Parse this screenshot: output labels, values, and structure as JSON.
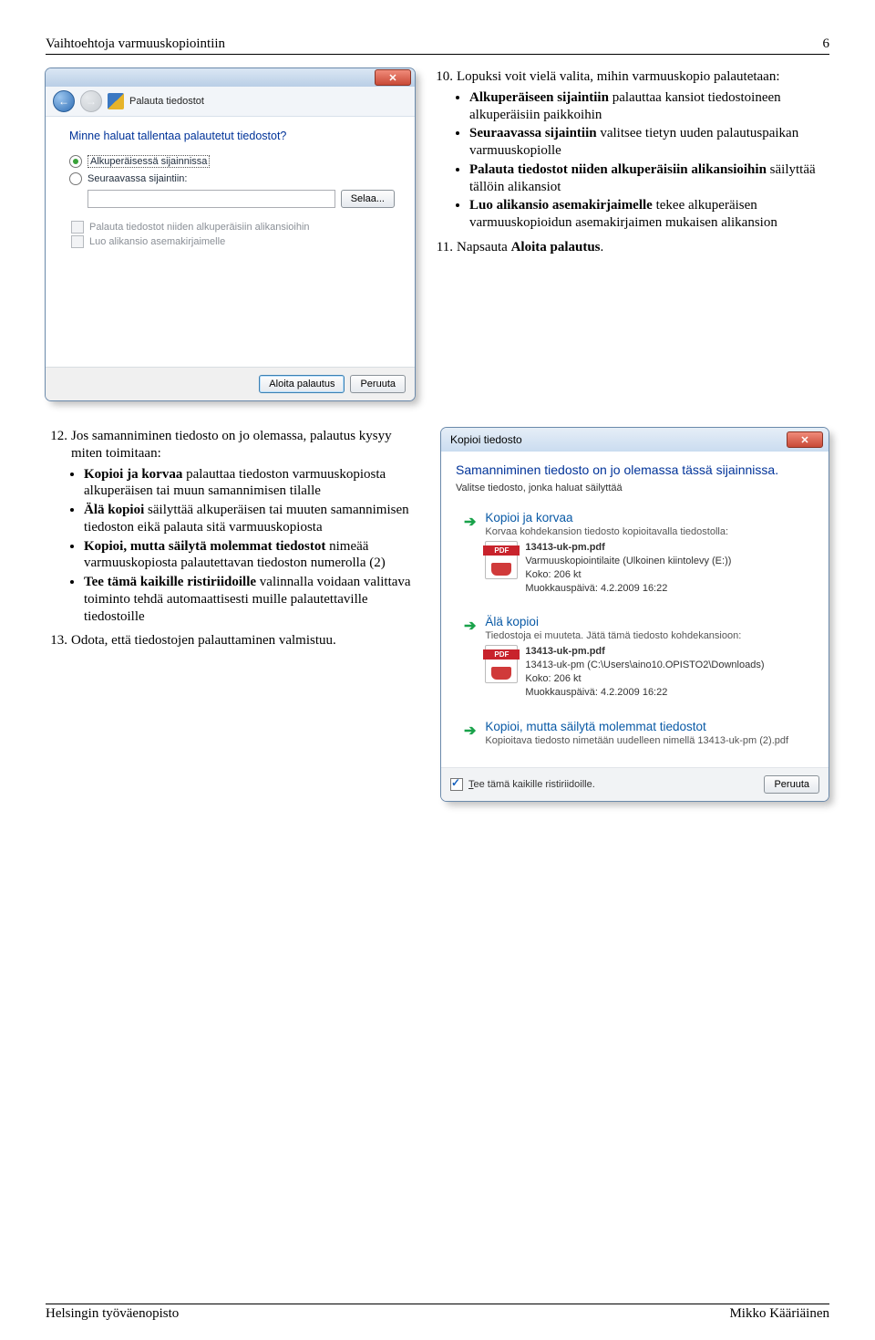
{
  "header": {
    "title": "Vaihtoehtoja varmuuskopiointiin",
    "page": "6"
  },
  "footer": {
    "left": "Helsingin työväenopisto",
    "right": "Mikko Kääriäinen"
  },
  "dialog1": {
    "title": "Palauta tiedostot",
    "question": "Minne haluat tallentaa palautetut tiedostot?",
    "opt1": "Alkuperäisessä sijainnissa",
    "opt2": "Seuraavassa sijaintiin:",
    "browse": "Selaa...",
    "chk1": "Palauta tiedostot niiden alkuperäisiin alikansioihin",
    "chk2": "Luo alikansio asemakirjaimelle",
    "btn_start": "Aloita palautus",
    "btn_cancel": "Peruuta"
  },
  "text10": {
    "num": "10.",
    "lead": "Lopuksi voit vielä valita, mihin varmuuskopio palautetaan:",
    "b1a": "Alkuperäiseen sijaintiin",
    "b1b": " palauttaa kansiot tiedostoineen alkuperäisiin paikkoihin",
    "b2a": "Seuraavassa sijaintiin",
    "b2b": " valitsee tietyn uuden palautuspaikan varmuuskopiolle",
    "b3a": "Palauta tiedostot niiden alkuperäisiin alikansioihin",
    "b3b": " säilyttää tällöin alikansiot",
    "b4a": "Luo alikansio asemakirjaimelle",
    "b4b": " tekee alkuperäisen varmuuskopioidun asemakirjaimen mukaisen alikansion"
  },
  "text11": {
    "num": "11.",
    "body_a": "Napsauta ",
    "body_b": "Aloita palautus",
    "body_c": "."
  },
  "text12": {
    "num": "12.",
    "lead": "Jos samanniminen tiedosto on jo olemassa, palautus kysyy miten toimitaan:",
    "b1a": "Kopioi ja korvaa",
    "b1b": " palauttaa tiedoston varmuuskopiosta alkuperäisen tai muun samannimisen tilalle",
    "b2a": "Älä kopioi",
    "b2b": " säilyttää alkuperäisen tai muuten samannimisen tiedoston eikä palauta sitä varmuuskopiosta",
    "b3a": "Kopioi, mutta säilytä molemmat tiedostot",
    "b3b": " nimeää varmuuskopiosta palautettavan tiedoston numerolla (2)",
    "b4a": "Tee tämä kaikille ristiriidoille",
    "b4b": " valinnalla voidaan valittava toiminto tehdä automaattisesti muille palautettaville tiedostoille"
  },
  "text13": {
    "num": "13.",
    "body": "Odota, että tiedostojen palauttaminen valmistuu."
  },
  "dialog2": {
    "title": "Kopioi tiedosto",
    "heading": "Samanniminen tiedosto on jo olemassa tässä sijainnissa.",
    "sub": "Valitse tiedosto, jonka haluat säilyttää",
    "o1_title": "Kopioi ja korvaa",
    "o1_sub": "Korvaa kohdekansion tiedosto kopioitavalla tiedostolla:",
    "file_name": "13413-uk-pm.pdf",
    "file_src": "Varmuuskopiointilaite (Ulkoinen kiintolevy (E:))",
    "file_size": "Koko: 206 kt",
    "file_date": "Muokkauspäivä: 4.2.2009 16:22",
    "o2_title": "Älä kopioi",
    "o2_sub": "Tiedostoja ei muuteta. Jätä tämä tiedosto kohdekansioon:",
    "file2_src": "13413-uk-pm (C:\\Users\\aino10.OPISTO2\\Downloads)",
    "o3_title": "Kopioi, mutta säilytä molemmat tiedostot",
    "o3_sub": "Kopioitava tiedosto nimetään uudelleen nimellä 13413-uk-pm (2).pdf",
    "foot_chk": "Tee tämä kaikille ristiriidoille.",
    "foot_btn": "Peruuta"
  }
}
